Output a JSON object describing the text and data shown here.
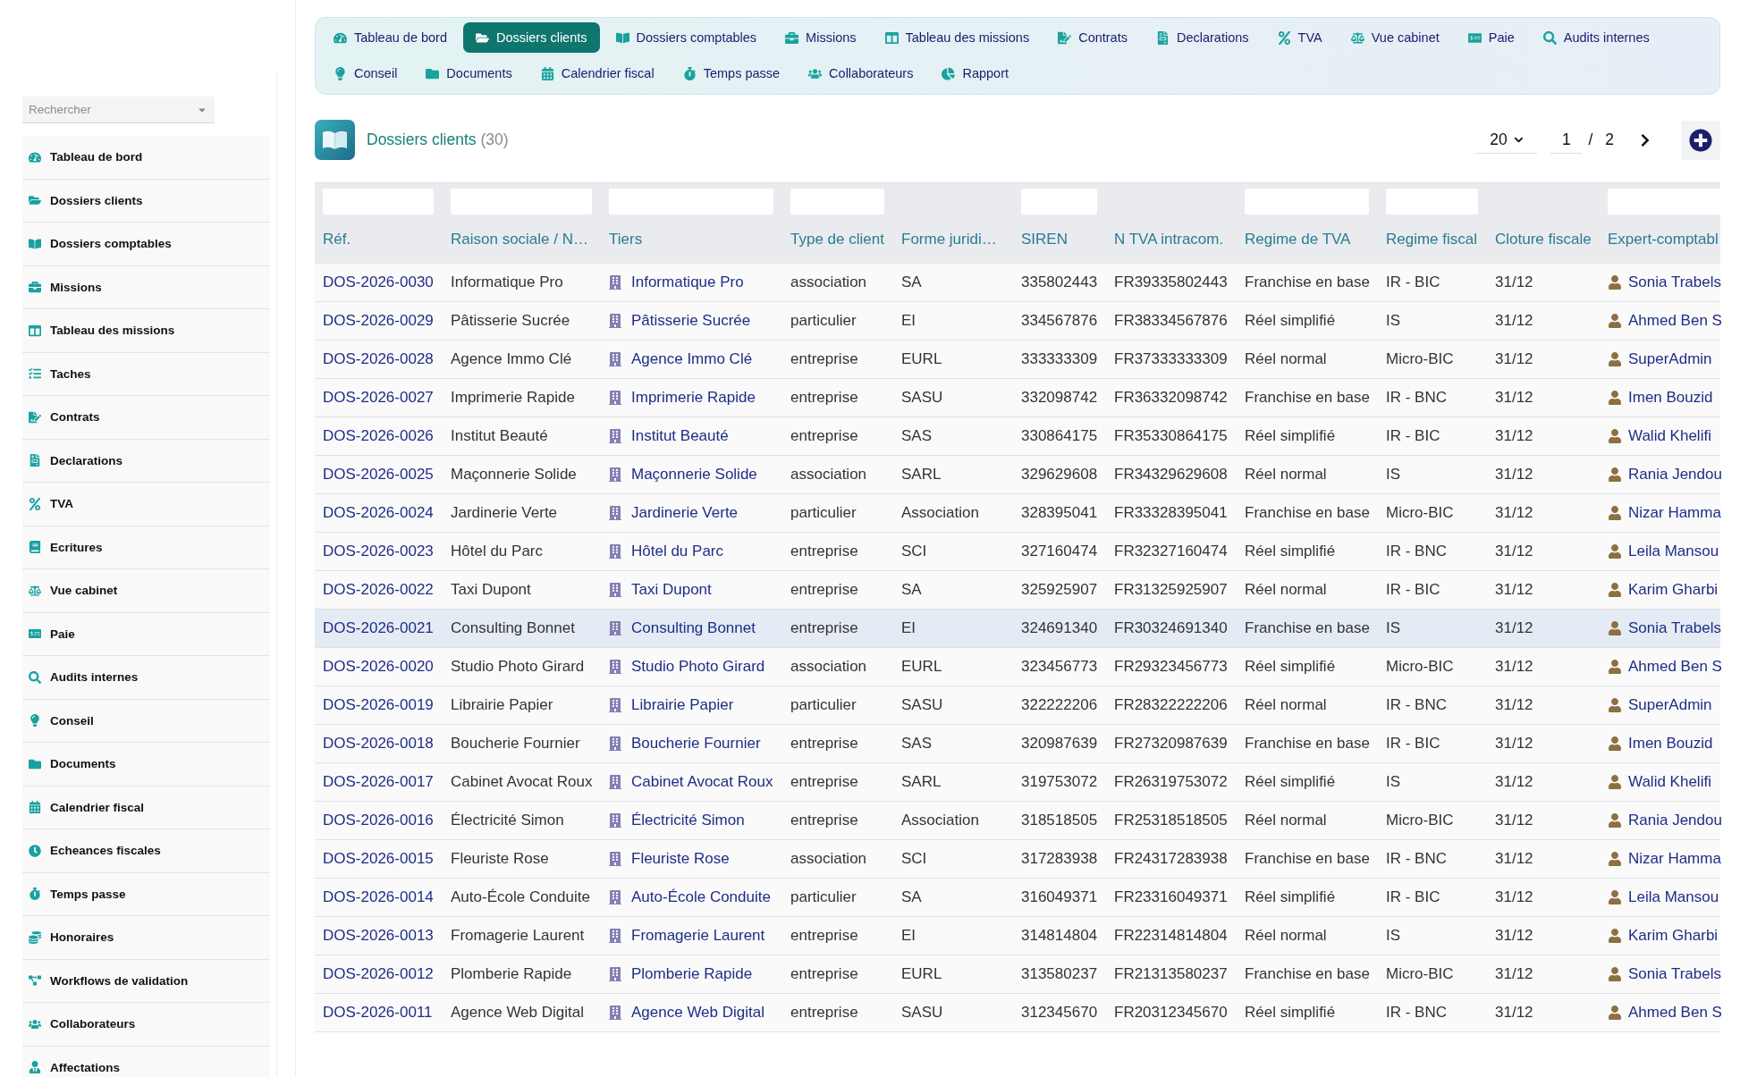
{
  "tabs": [
    {
      "label": "Tableau de bord",
      "selected": false
    },
    {
      "label": "Dossiers clients",
      "selected": true
    },
    {
      "label": "Dossiers comptables",
      "selected": false
    },
    {
      "label": "Missions",
      "selected": false
    },
    {
      "label": "Tableau des missions",
      "selected": false
    },
    {
      "label": "Contrats",
      "selected": false
    },
    {
      "label": "Declarations",
      "selected": false
    },
    {
      "label": "TVA",
      "selected": false
    },
    {
      "label": "Vue cabinet",
      "selected": false
    },
    {
      "label": "Paie",
      "selected": false
    },
    {
      "label": "Audits internes",
      "selected": false
    },
    {
      "label": "Conseil",
      "selected": false
    },
    {
      "label": "Documents",
      "selected": false
    },
    {
      "label": "Calendrier fiscal",
      "selected": false
    },
    {
      "label": "Temps passe",
      "selected": false
    },
    {
      "label": "Collaborateurs",
      "selected": false
    },
    {
      "label": "Rapport",
      "selected": false
    }
  ],
  "sidebar": {
    "search": {
      "placeholder": "Rechercher"
    },
    "items": [
      {
        "label": "Tableau de bord"
      },
      {
        "label": "Dossiers clients"
      },
      {
        "label": "Dossiers comptables"
      },
      {
        "label": "Missions"
      },
      {
        "label": "Tableau des missions"
      },
      {
        "label": "Taches"
      },
      {
        "label": "Contrats"
      },
      {
        "label": "Declarations"
      },
      {
        "label": "TVA"
      },
      {
        "label": "Ecritures"
      },
      {
        "label": "Vue cabinet"
      },
      {
        "label": "Paie"
      },
      {
        "label": "Audits internes"
      },
      {
        "label": "Conseil"
      },
      {
        "label": "Documents"
      },
      {
        "label": "Calendrier fiscal"
      },
      {
        "label": "Echeances fiscales"
      },
      {
        "label": "Temps passe"
      },
      {
        "label": "Honoraires"
      },
      {
        "label": "Workflows de validation"
      },
      {
        "label": "Collaborateurs"
      },
      {
        "label": "Affectations"
      }
    ]
  },
  "page_header": {
    "title": "Dossiers clients",
    "count": "(30)",
    "page_size": "20",
    "page": "1",
    "separator": "/",
    "page_count": "2"
  },
  "table": {
    "columns": [
      {
        "label": "Réf.",
        "kind": "link",
        "filter": true
      },
      {
        "label": "Raison sociale / N…",
        "kind": "text",
        "filter": true
      },
      {
        "label": "Tiers",
        "kind": "entity",
        "filter": true
      },
      {
        "label": "Type de client",
        "kind": "text",
        "filter": true
      },
      {
        "label": "Forme juridi…",
        "kind": "text",
        "filter": false
      },
      {
        "label": "SIREN",
        "kind": "text",
        "filter": true
      },
      {
        "label": "N TVA intracom.",
        "kind": "text",
        "filter": false
      },
      {
        "label": "Regime de TVA",
        "kind": "text",
        "filter": true
      },
      {
        "label": "Regime fiscal",
        "kind": "text",
        "filter": true
      },
      {
        "label": "Cloture fiscale",
        "kind": "text",
        "filter": false
      },
      {
        "label": "Expert-comptabl",
        "kind": "person",
        "filter": true
      }
    ],
    "rows": [
      {
        "selected": false,
        "cells": [
          "DOS-2026-0030",
          "Informatique Pro",
          "Informatique Pro",
          "association",
          "SA",
          "335802443",
          "FR39335802443",
          "Franchise en base",
          "IR - BIC",
          "31/12",
          "Sonia Trabels"
        ]
      },
      {
        "selected": false,
        "cells": [
          "DOS-2026-0029",
          "Pâtisserie Sucrée",
          "Pâtisserie Sucrée",
          "particulier",
          "EI",
          "334567876",
          "FR38334567876",
          "Réel simplifié",
          "IS",
          "31/12",
          "Ahmed Ben S"
        ]
      },
      {
        "selected": false,
        "cells": [
          "DOS-2026-0028",
          "Agence Immo Clé",
          "Agence Immo Clé",
          "entreprise",
          "EURL",
          "333333309",
          "FR37333333309",
          "Réel normal",
          "Micro-BIC",
          "31/12",
          "SuperAdmin"
        ]
      },
      {
        "selected": false,
        "cells": [
          "DOS-2026-0027",
          "Imprimerie Rapide",
          "Imprimerie Rapide",
          "entreprise",
          "SASU",
          "332098742",
          "FR36332098742",
          "Franchise en base",
          "IR - BNC",
          "31/12",
          "Imen Bouzid"
        ]
      },
      {
        "selected": false,
        "cells": [
          "DOS-2026-0026",
          "Institut Beauté",
          "Institut Beauté",
          "entreprise",
          "SAS",
          "330864175",
          "FR35330864175",
          "Réel simplifié",
          "IR - BIC",
          "31/12",
          "Walid Khelifi"
        ]
      },
      {
        "selected": false,
        "cells": [
          "DOS-2026-0025",
          "Maçonnerie Solide",
          "Maçonnerie Solide",
          "association",
          "SARL",
          "329629608",
          "FR34329629608",
          "Réel normal",
          "IS",
          "31/12",
          "Rania Jendou"
        ]
      },
      {
        "selected": false,
        "cells": [
          "DOS-2026-0024",
          "Jardinerie Verte",
          "Jardinerie Verte",
          "particulier",
          "Association",
          "328395041",
          "FR33328395041",
          "Franchise en base",
          "Micro-BIC",
          "31/12",
          "Nizar Hamma"
        ]
      },
      {
        "selected": false,
        "cells": [
          "DOS-2026-0023",
          "Hôtel du Parc",
          "Hôtel du Parc",
          "entreprise",
          "SCI",
          "327160474",
          "FR32327160474",
          "Réel simplifié",
          "IR - BNC",
          "31/12",
          "Leila Mansou"
        ]
      },
      {
        "selected": false,
        "cells": [
          "DOS-2026-0022",
          "Taxi Dupont",
          "Taxi Dupont",
          "entreprise",
          "SA",
          "325925907",
          "FR31325925907",
          "Réel normal",
          "IR - BIC",
          "31/12",
          "Karim Gharbi"
        ]
      },
      {
        "selected": true,
        "cells": [
          "DOS-2026-0021",
          "Consulting Bonnet",
          "Consulting Bonnet",
          "entreprise",
          "EI",
          "324691340",
          "FR30324691340",
          "Franchise en base",
          "IS",
          "31/12",
          "Sonia Trabels"
        ]
      },
      {
        "selected": false,
        "cells": [
          "DOS-2026-0020",
          "Studio Photo Girard",
          "Studio Photo Girard",
          "association",
          "EURL",
          "323456773",
          "FR29323456773",
          "Réel simplifié",
          "Micro-BIC",
          "31/12",
          "Ahmed Ben S"
        ]
      },
      {
        "selected": false,
        "cells": [
          "DOS-2026-0019",
          "Librairie Papier",
          "Librairie Papier",
          "particulier",
          "SASU",
          "322222206",
          "FR28322222206",
          "Réel normal",
          "IR - BNC",
          "31/12",
          "SuperAdmin"
        ]
      },
      {
        "selected": false,
        "cells": [
          "DOS-2026-0018",
          "Boucherie Fournier",
          "Boucherie Fournier",
          "entreprise",
          "SAS",
          "320987639",
          "FR27320987639",
          "Franchise en base",
          "IR - BIC",
          "31/12",
          "Imen Bouzid"
        ]
      },
      {
        "selected": false,
        "cells": [
          "DOS-2026-0017",
          "Cabinet Avocat Roux",
          "Cabinet Avocat Roux",
          "entreprise",
          "SARL",
          "319753072",
          "FR26319753072",
          "Réel simplifié",
          "IS",
          "31/12",
          "Walid Khelifi"
        ]
      },
      {
        "selected": false,
        "cells": [
          "DOS-2026-0016",
          "Électricité Simon",
          "Électricité Simon",
          "entreprise",
          "Association",
          "318518505",
          "FR25318518505",
          "Réel normal",
          "Micro-BIC",
          "31/12",
          "Rania Jendou"
        ]
      },
      {
        "selected": false,
        "cells": [
          "DOS-2026-0015",
          "Fleuriste Rose",
          "Fleuriste Rose",
          "association",
          "SCI",
          "317283938",
          "FR24317283938",
          "Franchise en base",
          "IR - BNC",
          "31/12",
          "Nizar Hamma"
        ]
      },
      {
        "selected": false,
        "cells": [
          "DOS-2026-0014",
          "Auto-École Conduite",
          "Auto-École Conduite",
          "particulier",
          "SA",
          "316049371",
          "FR23316049371",
          "Réel simplifié",
          "IR - BIC",
          "31/12",
          "Leila Mansou"
        ]
      },
      {
        "selected": false,
        "cells": [
          "DOS-2026-0013",
          "Fromagerie Laurent",
          "Fromagerie Laurent",
          "entreprise",
          "EI",
          "314814804",
          "FR22314814804",
          "Réel normal",
          "IS",
          "31/12",
          "Karim Gharbi"
        ]
      },
      {
        "selected": false,
        "cells": [
          "DOS-2026-0012",
          "Plomberie Rapide",
          "Plomberie Rapide",
          "entreprise",
          "EURL",
          "313580237",
          "FR21313580237",
          "Franchise en base",
          "Micro-BIC",
          "31/12",
          "Sonia Trabels"
        ]
      },
      {
        "selected": false,
        "cells": [
          "DOS-2026-0011",
          "Agence Web Digital",
          "Agence Web Digital",
          "entreprise",
          "SASU",
          "312345670",
          "FR20312345670",
          "Réel simplifié",
          "IR - BNC",
          "31/12",
          "Ahmed Ben S"
        ]
      }
    ]
  }
}
